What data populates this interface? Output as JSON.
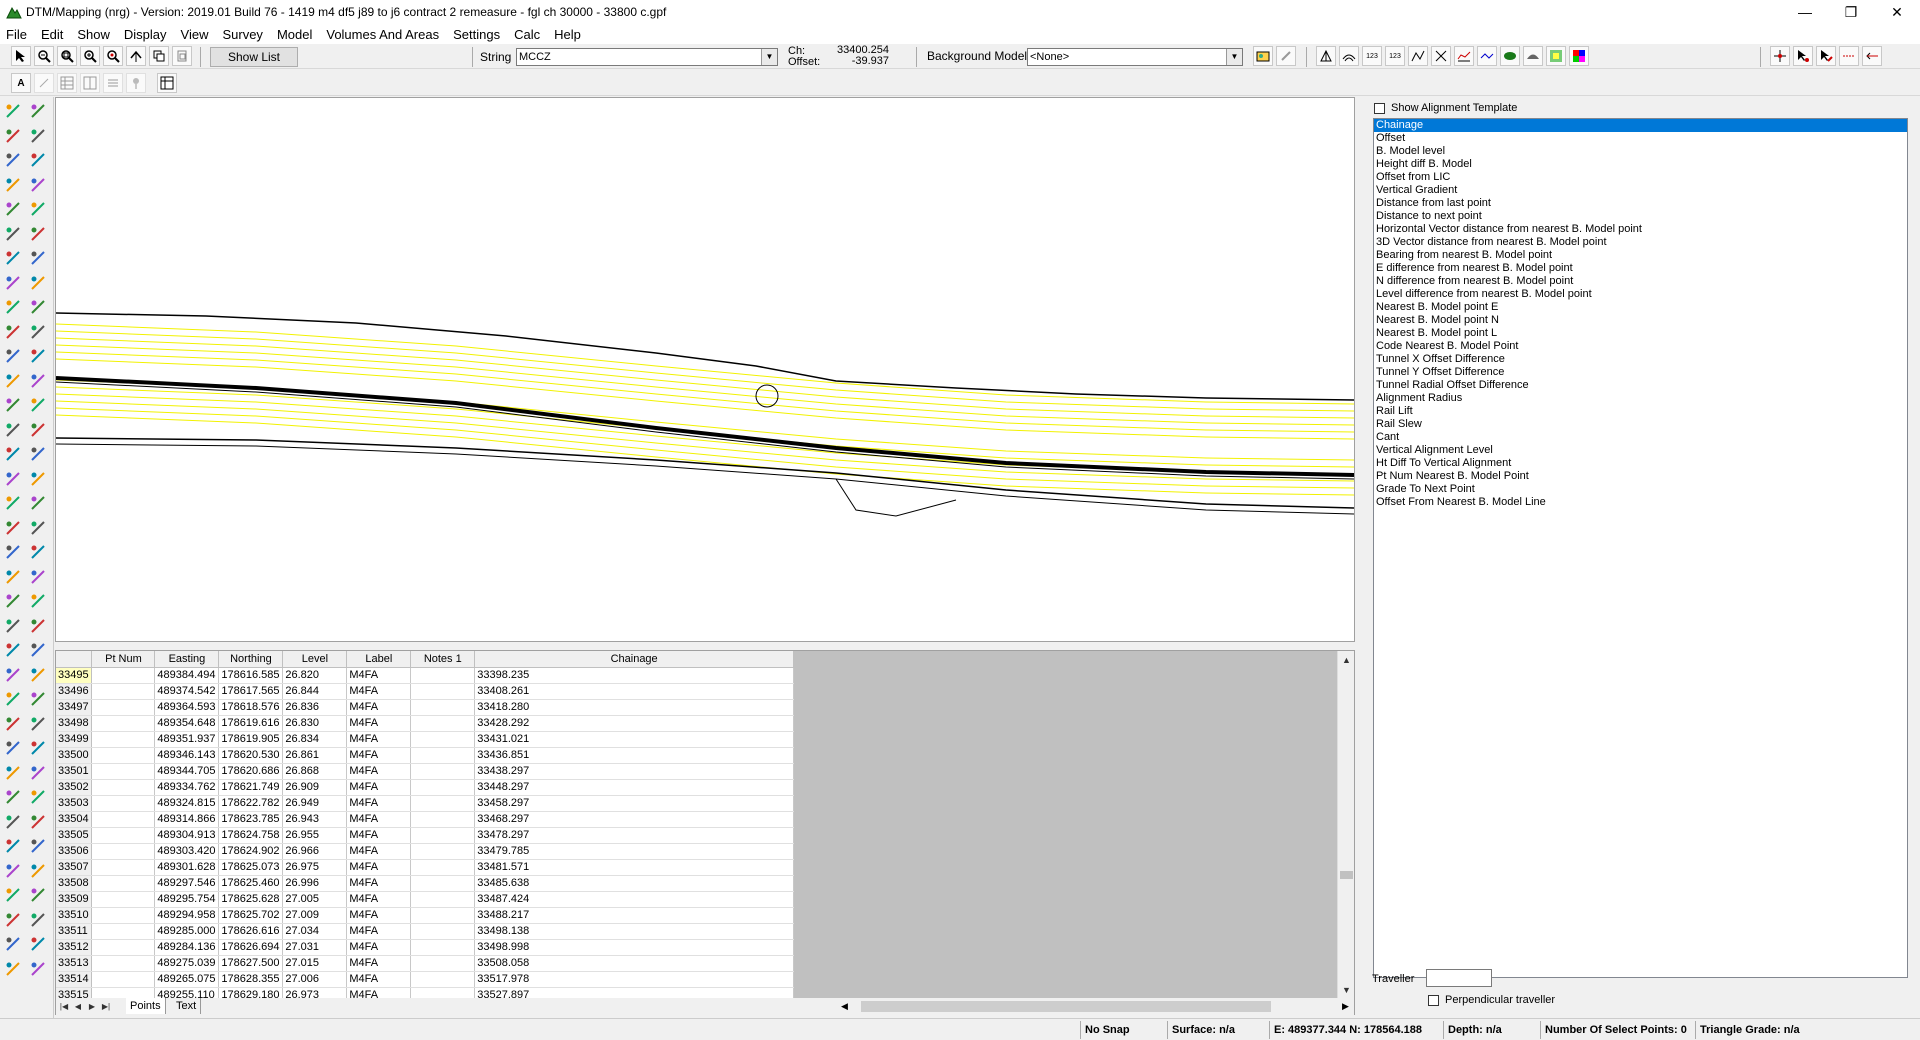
{
  "window": {
    "title": "DTM/Mapping (nrg) - Version: 2019.01 Build 76 - 1419 m4 df5 j89 to j6 contract 2 remeasure - fgl ch 30000 - 33800 c.gpf",
    "minimize": "—",
    "restore": "❐",
    "close": "✕"
  },
  "menu": [
    "File",
    "Edit",
    "Show",
    "Display",
    "View",
    "Survey",
    "Model",
    "Volumes And Areas",
    "Settings",
    "Calc",
    "Help"
  ],
  "toolbar": {
    "show_list": "Show List",
    "string_label": "String",
    "string_value": "MCCZ",
    "ch_label": "Ch:",
    "ch_value": "33400.254",
    "offset_label": "Offset:",
    "offset_value": "-39.937",
    "background_label": "Background Model:",
    "background_value": "<None>"
  },
  "table": {
    "columns": [
      "Pt Num",
      "Easting",
      "Northing",
      "Level",
      "Label",
      "Notes 1",
      "Chainage"
    ],
    "rows": [
      [
        "33495",
        "",
        "489384.494",
        "178616.585",
        "26.820",
        "M4FA",
        "",
        "33398.235"
      ],
      [
        "33496",
        "",
        "489374.542",
        "178617.565",
        "26.844",
        "M4FA",
        "",
        "33408.261"
      ],
      [
        "33497",
        "",
        "489364.593",
        "178618.576",
        "26.836",
        "M4FA",
        "",
        "33418.280"
      ],
      [
        "33498",
        "",
        "489354.648",
        "178619.616",
        "26.830",
        "M4FA",
        "",
        "33428.292"
      ],
      [
        "33499",
        "",
        "489351.937",
        "178619.905",
        "26.834",
        "M4FA",
        "",
        "33431.021"
      ],
      [
        "33500",
        "",
        "489346.143",
        "178620.530",
        "26.861",
        "M4FA",
        "",
        "33436.851"
      ],
      [
        "33501",
        "",
        "489344.705",
        "178620.686",
        "26.868",
        "M4FA",
        "",
        "33438.297"
      ],
      [
        "33502",
        "",
        "489334.762",
        "178621.749",
        "26.909",
        "M4FA",
        "",
        "33448.297"
      ],
      [
        "33503",
        "",
        "489324.815",
        "178622.782",
        "26.949",
        "M4FA",
        "",
        "33458.297"
      ],
      [
        "33504",
        "",
        "489314.866",
        "178623.785",
        "26.943",
        "M4FA",
        "",
        "33468.297"
      ],
      [
        "33505",
        "",
        "489304.913",
        "178624.758",
        "26.955",
        "M4FA",
        "",
        "33478.297"
      ],
      [
        "33506",
        "",
        "489303.420",
        "178624.902",
        "26.966",
        "M4FA",
        "",
        "33479.785"
      ],
      [
        "33507",
        "",
        "489301.628",
        "178625.073",
        "26.975",
        "M4FA",
        "",
        "33481.571"
      ],
      [
        "33508",
        "",
        "489297.546",
        "178625.460",
        "26.996",
        "M4FA",
        "",
        "33485.638"
      ],
      [
        "33509",
        "",
        "489295.754",
        "178625.628",
        "27.005",
        "M4FA",
        "",
        "33487.424"
      ],
      [
        "33510",
        "",
        "489294.958",
        "178625.702",
        "27.009",
        "M4FA",
        "",
        "33488.217"
      ],
      [
        "33511",
        "",
        "489285.000",
        "178626.616",
        "27.034",
        "M4FA",
        "",
        "33498.138"
      ],
      [
        "33512",
        "",
        "489284.136",
        "178626.694",
        "27.031",
        "M4FA",
        "",
        "33498.998"
      ],
      [
        "33513",
        "",
        "489275.039",
        "178627.500",
        "27.015",
        "M4FA",
        "",
        "33508.058"
      ],
      [
        "33514",
        "",
        "489265.075",
        "178628.355",
        "27.006",
        "M4FA",
        "",
        "33517.978"
      ],
      [
        "33515",
        "",
        "489255.110",
        "178629.180",
        "26.973",
        "M4FA",
        "",
        "33527.897"
      ]
    ],
    "tabs": [
      "Points",
      "Text"
    ]
  },
  "right_panel": {
    "show_alignment_template": "Show Alignment Template",
    "items": [
      "Chainage",
      "Offset",
      "B. Model level",
      "Height diff B. Model",
      "Offset from LIC",
      "Vertical Gradient",
      "Distance from last point",
      "Distance to next point",
      "Horizontal Vector distance from nearest B. Model point",
      "3D Vector distance from nearest B. Model point",
      "Bearing from nearest B. Model point",
      "E difference from nearest B. Model point",
      "N difference from nearest B. Model point",
      "Level difference from nearest B. Model point",
      "Nearest B. Model point E",
      "Nearest B. Model point N",
      "Nearest B. Model point L",
      "Code Nearest B. Model Point",
      "Tunnel X Offset Difference",
      "Tunnel Y Offset Difference",
      "Tunnel Radial Offset Difference",
      "Alignment Radius",
      "Rail Lift",
      "Rail Slew",
      "Cant",
      "Vertical Alignment Level",
      "Ht Diff To Vertical Alignment",
      "Pt Num Nearest B. Model Point",
      "Grade To Next Point",
      "Offset From Nearest B. Model Line"
    ],
    "selected_index": 0,
    "traveller_label": "Traveller",
    "perpendicular_label": "Perpendicular traveller"
  },
  "status": {
    "snap": "No Snap",
    "surface": "Surface: n/a",
    "coords": "E: 489377.344  N: 178564.188",
    "depth": "Depth: n/a",
    "select_points": "Number Of Select Points: 0",
    "triangle_grade": "Triangle Grade: n/a"
  },
  "colors": {
    "selection": "#0078d7",
    "contour": "#f2f200",
    "linework": "#000000"
  }
}
